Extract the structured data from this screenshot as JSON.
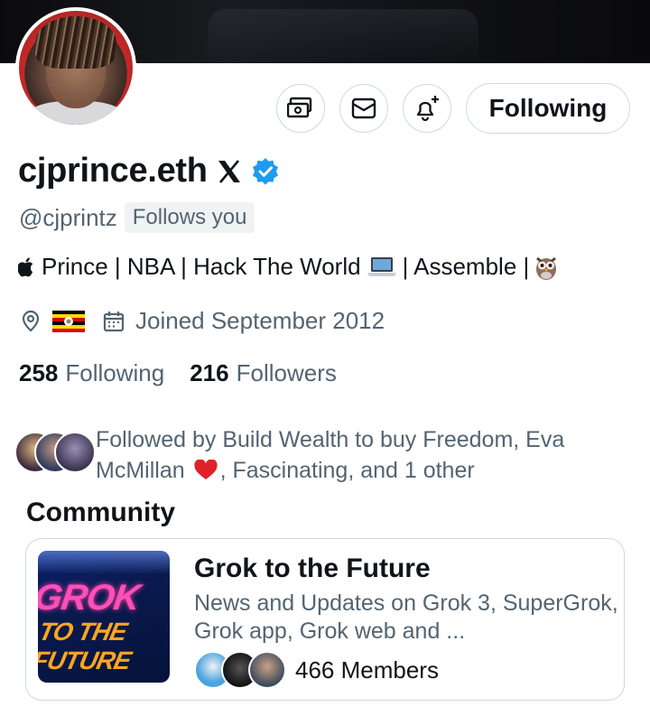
{
  "profile": {
    "display_name": "cjprince.eth",
    "handle": "@cjprintz",
    "follows_you_label": "Follows you",
    "bio_text": "Prince | NBA | Hack The World",
    "bio_text_2": "| Assemble |",
    "joined": "Joined September 2012",
    "following_count": "258",
    "following_label": "Following",
    "followers_count": "216",
    "followers_label": "Followers",
    "verified_color": "#1d9bf0"
  },
  "actions": {
    "follow_button_label": "Following",
    "icons": [
      "money-icon",
      "mail-icon",
      "bell-plus-icon"
    ]
  },
  "followed_by": {
    "text_line1": "Followed by Build Wealth to buy Freedom, Eva",
    "text_line2_a": "McMillan",
    "text_line2_b": ", Fascinating, and 1 other"
  },
  "community": {
    "section_title": "Community",
    "name": "Grok to the Future",
    "description": "News and Updates on Grok 3, SuperGrok, Grok app, Grok web and ...",
    "members": "466 Members",
    "thumb_line1": "GROK",
    "thumb_line2": "TO THE FUTURE"
  },
  "colors": {
    "text_primary": "#0f1419",
    "text_secondary": "#536471",
    "border": "#cfd9de"
  }
}
